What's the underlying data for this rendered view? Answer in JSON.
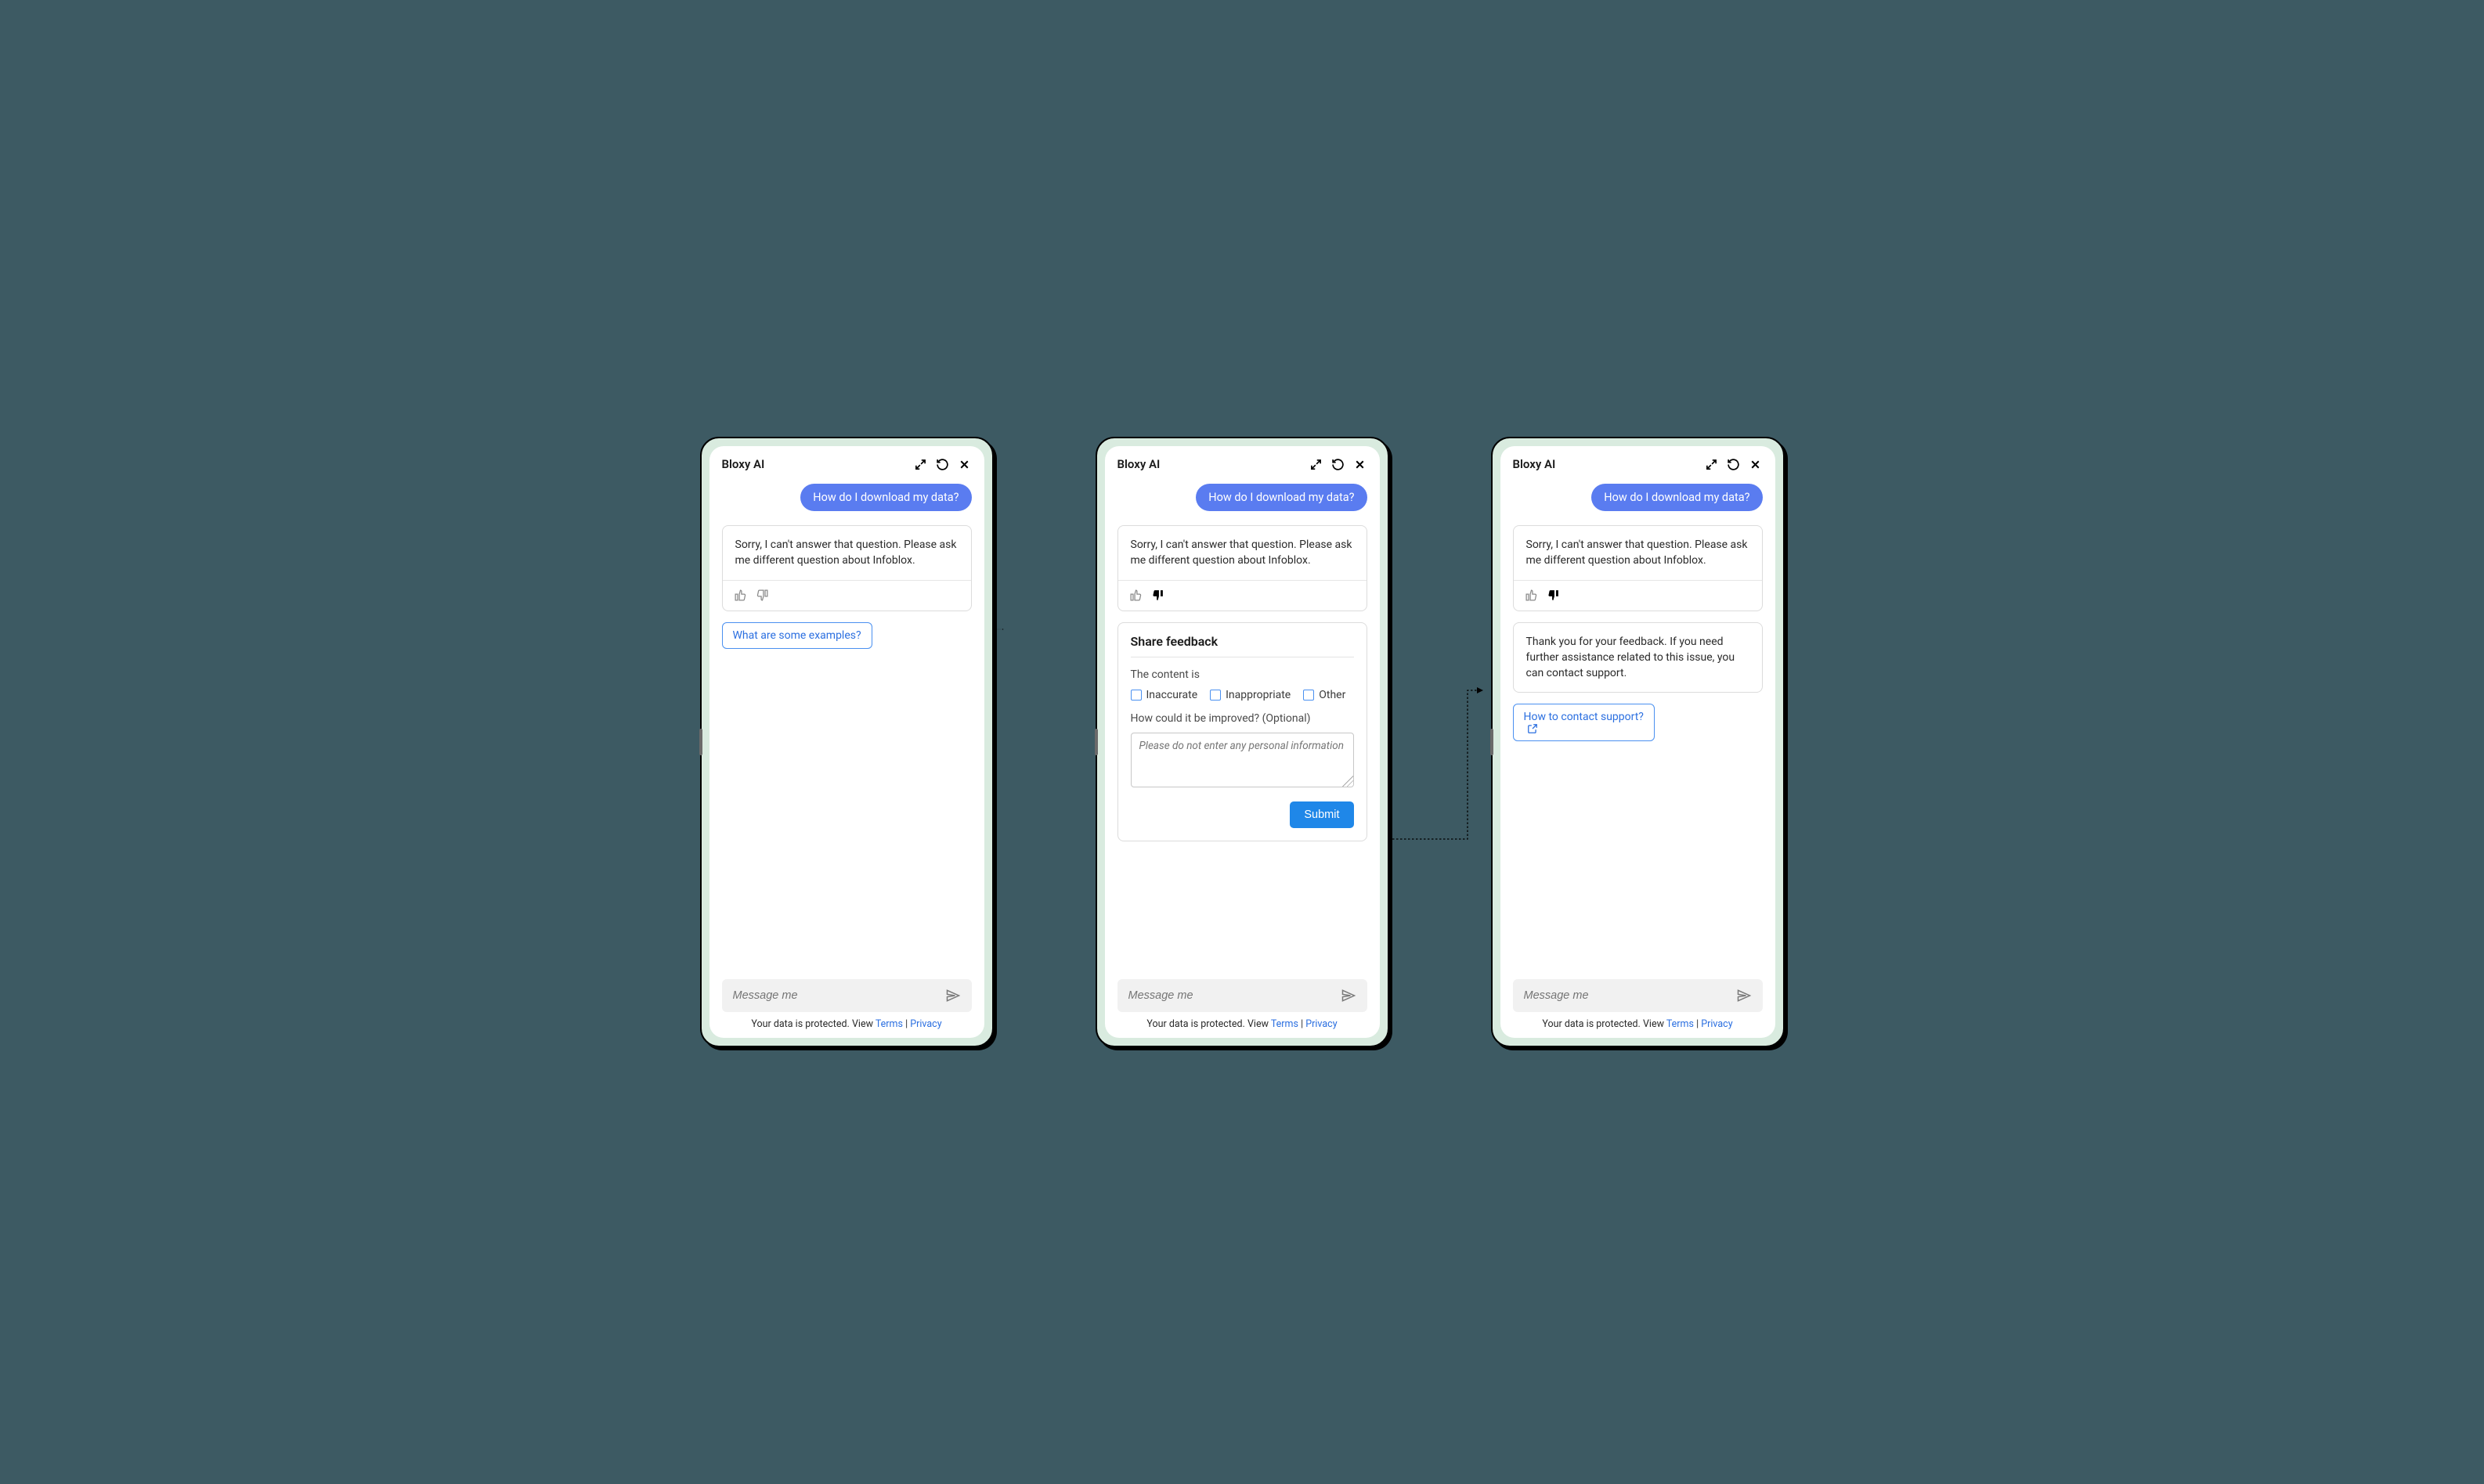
{
  "app_title": "Bloxy AI",
  "user_message": "How do I download my data?",
  "bot_reply": "Sorry, I can't answer that question. Please ask me different question about Infoblox.",
  "suggestion_examples": "What are some examples?",
  "feedback": {
    "title": "Share feedback",
    "content_label": "The content is",
    "opt_inaccurate": "Inaccurate",
    "opt_inappropriate": "Inappropriate",
    "opt_other": "Other",
    "improve_label": "How could it be improved? (Optional)",
    "placeholder": "Please do not enter any personal information",
    "submit": "Submit"
  },
  "thankyou_text": "Thank you for your feedback. If you need further assistance related to this issue, you can contact support.",
  "suggestion_support": "How to contact support?",
  "input_placeholder": "Message me",
  "legal_prefix": "Your data is protected. View ",
  "legal_terms": "Terms",
  "legal_privacy": "Privacy",
  "legal_sep": " | "
}
